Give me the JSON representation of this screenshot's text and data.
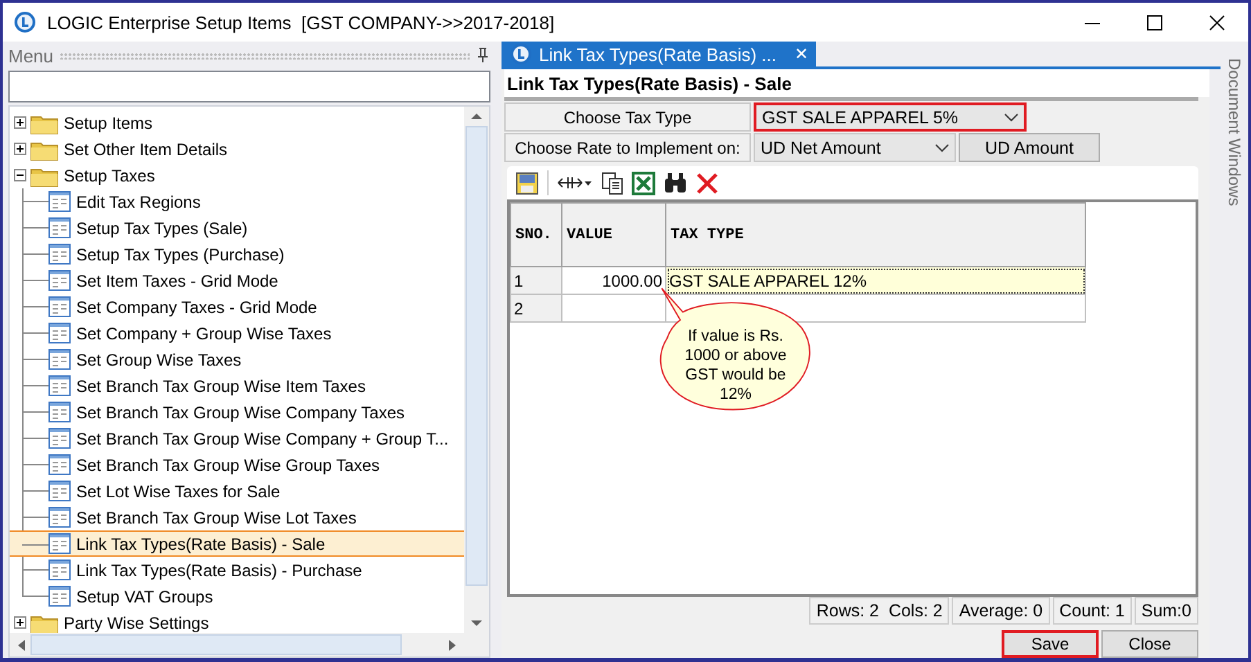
{
  "window": {
    "title": "LOGIC Enterprise Setup Items  [GST COMPANY->>2017-2018]"
  },
  "menu": {
    "title": "Menu",
    "items": [
      {
        "kind": "folder",
        "label": "Setup Items",
        "expanded": false,
        "selected": false
      },
      {
        "kind": "folder",
        "label": "Set Other Item Details",
        "expanded": false,
        "selected": false
      },
      {
        "kind": "folder",
        "label": "Setup Taxes",
        "expanded": true,
        "selected": false,
        "children": [
          {
            "kind": "form",
            "label": "Edit Tax Regions",
            "selected": false
          },
          {
            "kind": "form",
            "label": "Setup Tax Types (Sale)",
            "selected": false
          },
          {
            "kind": "form",
            "label": "Setup Tax Types (Purchase)",
            "selected": false
          },
          {
            "kind": "form",
            "label": "Set Item Taxes - Grid Mode",
            "selected": false
          },
          {
            "kind": "form",
            "label": "Set Company Taxes - Grid Mode",
            "selected": false
          },
          {
            "kind": "form",
            "label": "Set Company + Group Wise Taxes",
            "selected": false
          },
          {
            "kind": "form",
            "label": "Set Group Wise Taxes",
            "selected": false
          },
          {
            "kind": "form",
            "label": "Set Branch Tax Group Wise Item Taxes",
            "selected": false
          },
          {
            "kind": "form",
            "label": "Set Branch Tax Group Wise Company Taxes",
            "selected": false
          },
          {
            "kind": "form",
            "label": "Set Branch Tax Group Wise Company + Group T...",
            "selected": false
          },
          {
            "kind": "form",
            "label": "Set Branch Tax Group Wise Group Taxes",
            "selected": false
          },
          {
            "kind": "form",
            "label": "Set Lot Wise Taxes for Sale",
            "selected": false
          },
          {
            "kind": "form",
            "label": "Set Branch Tax Group Wise Lot Taxes",
            "selected": false
          },
          {
            "kind": "form",
            "label": "Link Tax Types(Rate Basis) - Sale",
            "selected": true
          },
          {
            "kind": "form",
            "label": "Link Tax Types(Rate Basis) - Purchase",
            "selected": false
          },
          {
            "kind": "form",
            "label": "Setup VAT Groups",
            "selected": false
          }
        ]
      },
      {
        "kind": "folder",
        "label": "Party Wise Settings",
        "expanded": false,
        "selected": false
      }
    ]
  },
  "document_tab": {
    "label": "Link Tax Types(Rate Basis) ...",
    "close": "✕"
  },
  "form": {
    "title": "Link Tax Types(Rate Basis) - Sale",
    "tax_type": {
      "label": "Choose Tax Type",
      "value": "GST SALE APPAREL 5%",
      "highlighted": true
    },
    "rate_on": {
      "label": "Choose Rate to Implement on:",
      "value": "UD Net Amount",
      "highlighted": false,
      "button": "UD Amount"
    }
  },
  "grid": {
    "columns": [
      "SNO.",
      "VALUE",
      "TAX TYPE"
    ],
    "rows": [
      {
        "sno": "1",
        "value": "1000.00",
        "tax_type": "GST SALE APPAREL 12%",
        "selected": true
      },
      {
        "sno": "2",
        "selected": false
      }
    ],
    "callout": "If value is Rs. 1000 or above GST would be 12%"
  },
  "status_bar": [
    "Rows: 2  Cols: 2",
    "Average: 0",
    "Count: 1",
    "Sum:0"
  ],
  "buttons": [
    {
      "label": "Save",
      "highlighted": true
    },
    {
      "label": "Close",
      "highlighted": false
    }
  ],
  "side_strip": {
    "label": "Document Windows"
  }
}
